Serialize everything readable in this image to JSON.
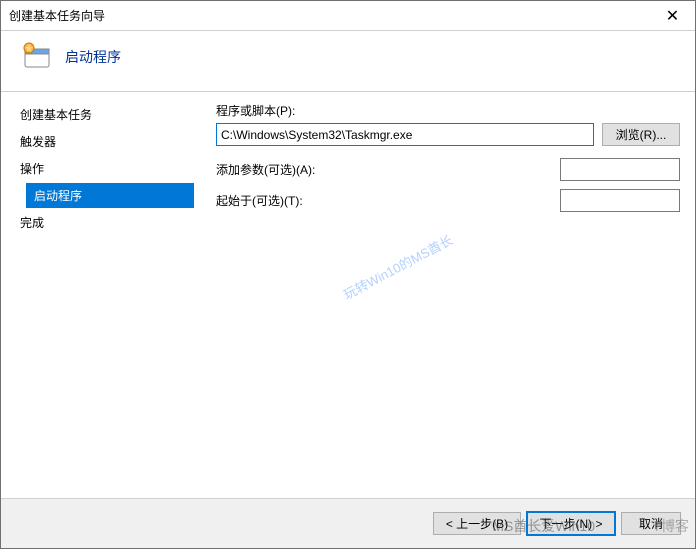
{
  "window": {
    "title": "创建基本任务向导",
    "close_glyph": "✕"
  },
  "header": {
    "title": "启动程序"
  },
  "sidebar": {
    "items": [
      {
        "label": "创建基本任务"
      },
      {
        "label": "触发器"
      },
      {
        "label": "操作"
      },
      {
        "label": "启动程序"
      },
      {
        "label": "完成"
      }
    ]
  },
  "form": {
    "program_label": "程序或脚本(P):",
    "program_value": "C:\\Windows\\System32\\Taskmgr.exe",
    "browse_label": "浏览(R)...",
    "args_label": "添加参数(可选)(A):",
    "args_value": "",
    "startin_label": "起始于(可选)(T):",
    "startin_value": ""
  },
  "footer": {
    "back_label": "< 上一步(B)",
    "next_label": "下一步(N) >",
    "cancel_label": "取消"
  },
  "watermarks": {
    "diag": "玩转Win10的MS酋长",
    "footer1": "MS酋长爱Win10",
    "footer2": "T博客"
  }
}
